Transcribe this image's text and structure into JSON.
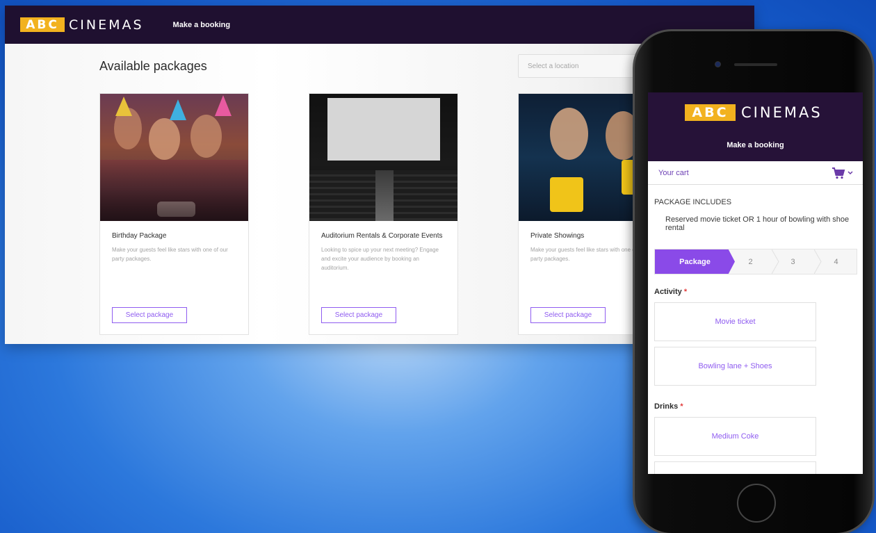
{
  "brand": {
    "abc": "ABC",
    "cinemas": "CINEMAS",
    "accent": "#8f5cf0",
    "header_bg": "#1f1030",
    "logo_yellow": "#f2b21f"
  },
  "desktop": {
    "nav": "Make a booking",
    "title": "Available packages",
    "location_placeholder": "Select a location",
    "cards": [
      {
        "title": "Birthday Package",
        "desc": "Make your guests feel like stars with one of our party packages.",
        "button": "Select package",
        "image": "birthday-party-photo"
      },
      {
        "title": "Auditorium Rentals & Corporate Events",
        "desc": "Looking to spice up your next meeting? Engage and excite your audience by booking an auditorium.",
        "button": "Select package",
        "image": "auditorium-photo"
      },
      {
        "title": "Private Showings",
        "desc": "Make your guests feel like stars with one of our party packages.",
        "button": "Select package",
        "image": "moviegoers-photo"
      }
    ]
  },
  "mobile": {
    "nav": "Make a booking",
    "cart_label": "Your cart",
    "cart_icon": "cart-icon",
    "package_includes": "PACKAGE INCLUDES",
    "package_desc": "Reserved movie ticket OR 1 hour of bowling with shoe rental",
    "steps": [
      "Package",
      "2",
      "3",
      "4"
    ],
    "activity_label": "Activity",
    "activity_options": [
      "Movie ticket",
      "Bowling lane + Shoes"
    ],
    "drinks_label": "Drinks",
    "drinks_options": [
      "Medium Coke",
      ""
    ],
    "required_mark": "*"
  }
}
